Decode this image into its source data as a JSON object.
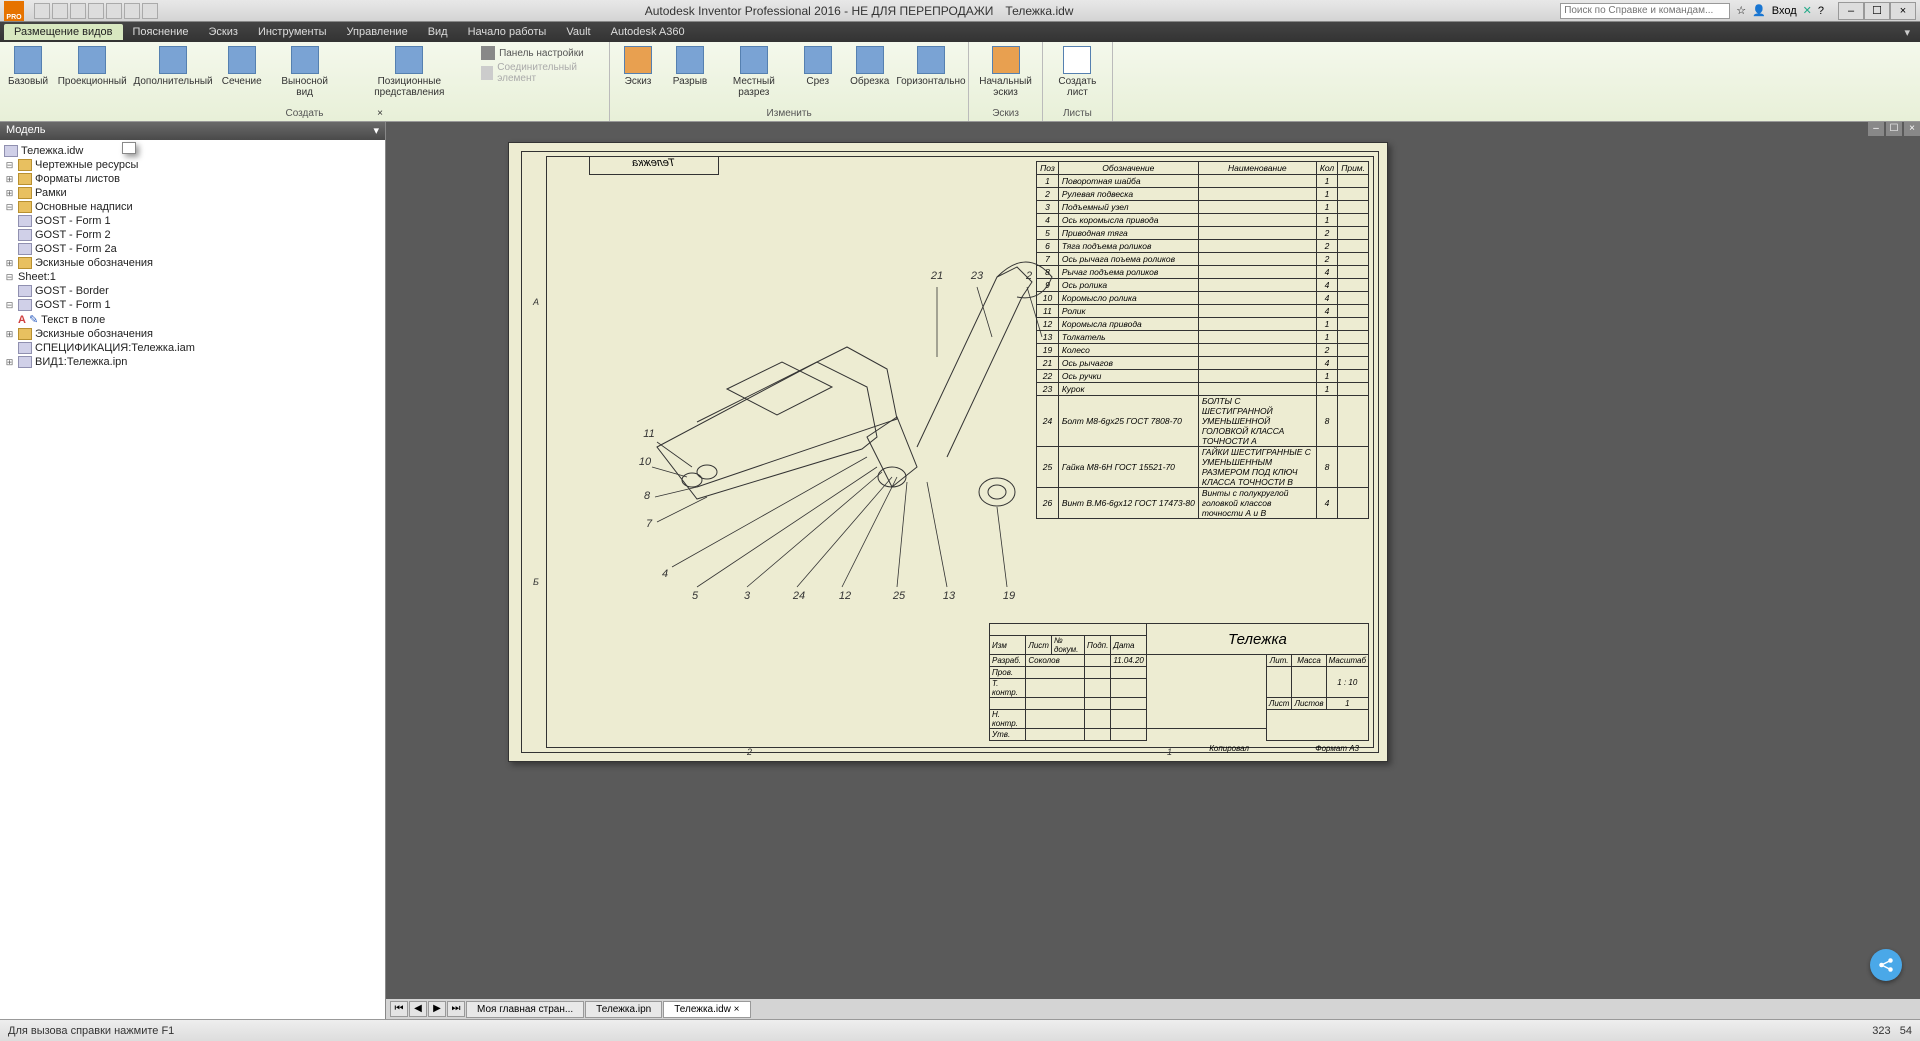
{
  "title": {
    "app": "Autodesk Inventor Professional 2016 - НЕ ДЛЯ ПЕРЕПРОДАЖИ",
    "doc": "Тележка.idw",
    "pro": "PRO"
  },
  "search": {
    "placeholder": "Поиск по Справке и командам..."
  },
  "login": "Вход",
  "menutabs": [
    "Размещение видов",
    "Пояснение",
    "Эскиз",
    "Инструменты",
    "Управление",
    "Вид",
    "Начало работы",
    "Vault",
    "Autodesk A360"
  ],
  "ribbon": {
    "create": {
      "label": "Создать",
      "btns": [
        "Базовый",
        "Проекционный",
        "Дополнительный",
        "Сечение",
        "Выносной вид",
        "Позиционные представления"
      ],
      "side": {
        "panel": "Панель настройки",
        "conn": "Соединительный элемент"
      }
    },
    "modify": {
      "label": "Изменить",
      "btns": [
        "Эскиз",
        "Разрыв",
        "Местный разрез",
        "Срез",
        "Обрезка",
        "Горизонтально"
      ]
    },
    "sketch": {
      "label": "Эскиз",
      "btn": "Начальный эскиз"
    },
    "sheets": {
      "label": "Листы",
      "btn": "Создать лист"
    }
  },
  "browser": {
    "title": "Модель",
    "root": "Тележка.idw",
    "res": "Чертежные ресурсы",
    "fmt": "Форматы листов",
    "frames": "Рамки",
    "titles": "Основные надписи",
    "g1": "GOST - Form 1",
    "g2": "GOST - Form 2",
    "g2a": "GOST - Form 2a",
    "sketch": "Эскизные обозначения",
    "sheet": "Sheet:1",
    "border": "GOST - Border",
    "form1": "GOST - Form 1",
    "txt": "Текст в поле",
    "sketch2": "Эскизные обозначения",
    "spec": "СПЕЦИФИКАЦИЯ:Тележка.iam",
    "view": "ВИД1:Тележка.ipn"
  },
  "part_cols": {
    "pos": "Поз",
    "des": "Обозначение",
    "name": "Наименование",
    "qty": "Кол",
    "note": "Прим."
  },
  "parts": [
    {
      "p": "1",
      "d": "Поворотная шайба",
      "n": "",
      "q": "1"
    },
    {
      "p": "2",
      "d": "Рулевая подвеска",
      "n": "",
      "q": "1"
    },
    {
      "p": "3",
      "d": "Подъемный узел",
      "n": "",
      "q": "1"
    },
    {
      "p": "4",
      "d": "Ось коромысла привода",
      "n": "",
      "q": "1"
    },
    {
      "p": "5",
      "d": "Приводная тяга",
      "n": "",
      "q": "2"
    },
    {
      "p": "6",
      "d": "Тяга подъема роликов",
      "n": "",
      "q": "2"
    },
    {
      "p": "7",
      "d": "Ось рычага поъема роликов",
      "n": "",
      "q": "2"
    },
    {
      "p": "8",
      "d": "Рычаг подъема роликов",
      "n": "",
      "q": "4"
    },
    {
      "p": "9",
      "d": "Ось ролика",
      "n": "",
      "q": "4"
    },
    {
      "p": "10",
      "d": "Коромысло ролика",
      "n": "",
      "q": "4"
    },
    {
      "p": "11",
      "d": "Ролик",
      "n": "",
      "q": "4"
    },
    {
      "p": "12",
      "d": "Коромысла привода",
      "n": "",
      "q": "1"
    },
    {
      "p": "13",
      "d": "Толкатель",
      "n": "",
      "q": "1"
    },
    {
      "p": "19",
      "d": "Колесо",
      "n": "",
      "q": "2"
    },
    {
      "p": "21",
      "d": "Ось рычагов",
      "n": "",
      "q": "4"
    },
    {
      "p": "22",
      "d": "Ось ручки",
      "n": "",
      "q": "1"
    },
    {
      "p": "23",
      "d": "Курок",
      "n": "",
      "q": "1"
    },
    {
      "p": "24",
      "d": "Болт M8-6gx25 ГОСТ 7808-70",
      "n": "БОЛТЫ С ШЕСТИГРАННОЙ УМЕНЬШЕННОЙ ГОЛОВКОЙ КЛАССА ТОЧНОСТИ А",
      "q": "8"
    },
    {
      "p": "25",
      "d": "Гайка M8-6H ГОСТ 15521-70",
      "n": "ГАЙКИ ШЕСТИГРАННЫЕ С УМЕНЬШЕННЫМ РАЗМЕРОМ ПОД КЛЮЧ КЛАССА ТОЧНОСТИ В",
      "q": "8"
    },
    {
      "p": "26",
      "d": "Винт В.М6-6gx12 ГОСТ 17473-80",
      "n": "Винты с полукруглой головкой классов точности А и В",
      "q": "4"
    }
  ],
  "tb": {
    "name": "Тележка",
    "scale": "1 : 10",
    "sheet": "Лист",
    "sheets": "Листов",
    "sheetnum": "1",
    "lit": "Лит.",
    "mass": "Масса",
    "msh": "Масштаб",
    "r_izm": "Изм",
    "r_list": "Лист",
    "r_doc": "№ докум.",
    "r_sign": "Подп.",
    "r_date": "Дата",
    "dev": "Разраб.",
    "devname": "Соколов",
    "devdate": "11.04.20",
    "chk": "Пров.",
    "tctl": "Т. контр.",
    "nctl": "Н. контр.",
    "appr": "Утв.",
    "kopir": "Копировал",
    "fmt": "Формат А3"
  },
  "titletag": "Тележка",
  "callouts_top": [
    "21",
    "23",
    "2"
  ],
  "callouts_left": [
    "11",
    "10",
    "8",
    "7",
    "4"
  ],
  "callouts_bot": [
    "5",
    "3",
    "24",
    "12",
    "25",
    "13",
    "19"
  ],
  "bottom_tabs": [
    "Моя главная стран...",
    "Тележка.ipn",
    "Тележка.idw ×"
  ],
  "status": {
    "help": "Для вызова справки нажмите F1",
    "x": "323",
    "y": "54"
  }
}
